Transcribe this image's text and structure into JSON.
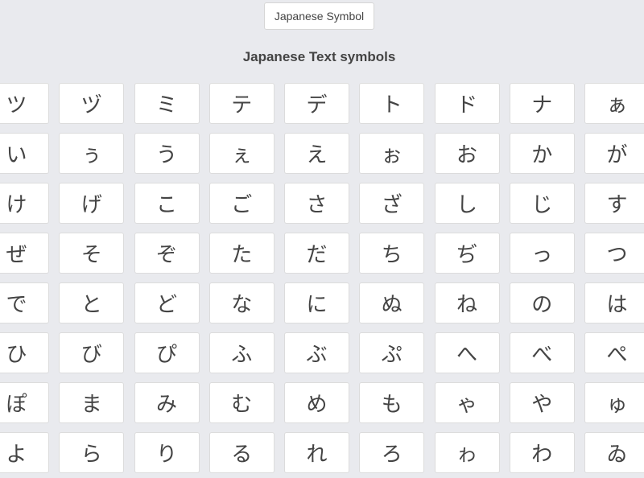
{
  "header": {
    "button_label": "Japanese Symbol",
    "title": "Japanese Text symbols"
  },
  "symbols": [
    [
      "ツ",
      "ヅ",
      "ミ",
      "テ",
      "デ",
      "ト",
      "ド",
      "ナ",
      "ぁ"
    ],
    [
      "い",
      "ぅ",
      "う",
      "ぇ",
      "え",
      "ぉ",
      "お",
      "か",
      "が"
    ],
    [
      "け",
      "げ",
      "こ",
      "ご",
      "さ",
      "ざ",
      "し",
      "じ",
      "す"
    ],
    [
      "ぜ",
      "そ",
      "ぞ",
      "た",
      "だ",
      "ち",
      "ぢ",
      "っ",
      "つ"
    ],
    [
      "で",
      "と",
      "ど",
      "な",
      "に",
      "ぬ",
      "ね",
      "の",
      "は"
    ],
    [
      "ひ",
      "び",
      "ぴ",
      "ふ",
      "ぶ",
      "ぷ",
      "へ",
      "べ",
      "ぺ"
    ],
    [
      "ぽ",
      "ま",
      "み",
      "む",
      "め",
      "も",
      "ゃ",
      "や",
      "ゅ"
    ],
    [
      "よ",
      "ら",
      "り",
      "る",
      "れ",
      "ろ",
      "ゎ",
      "わ",
      "ゐ"
    ]
  ]
}
